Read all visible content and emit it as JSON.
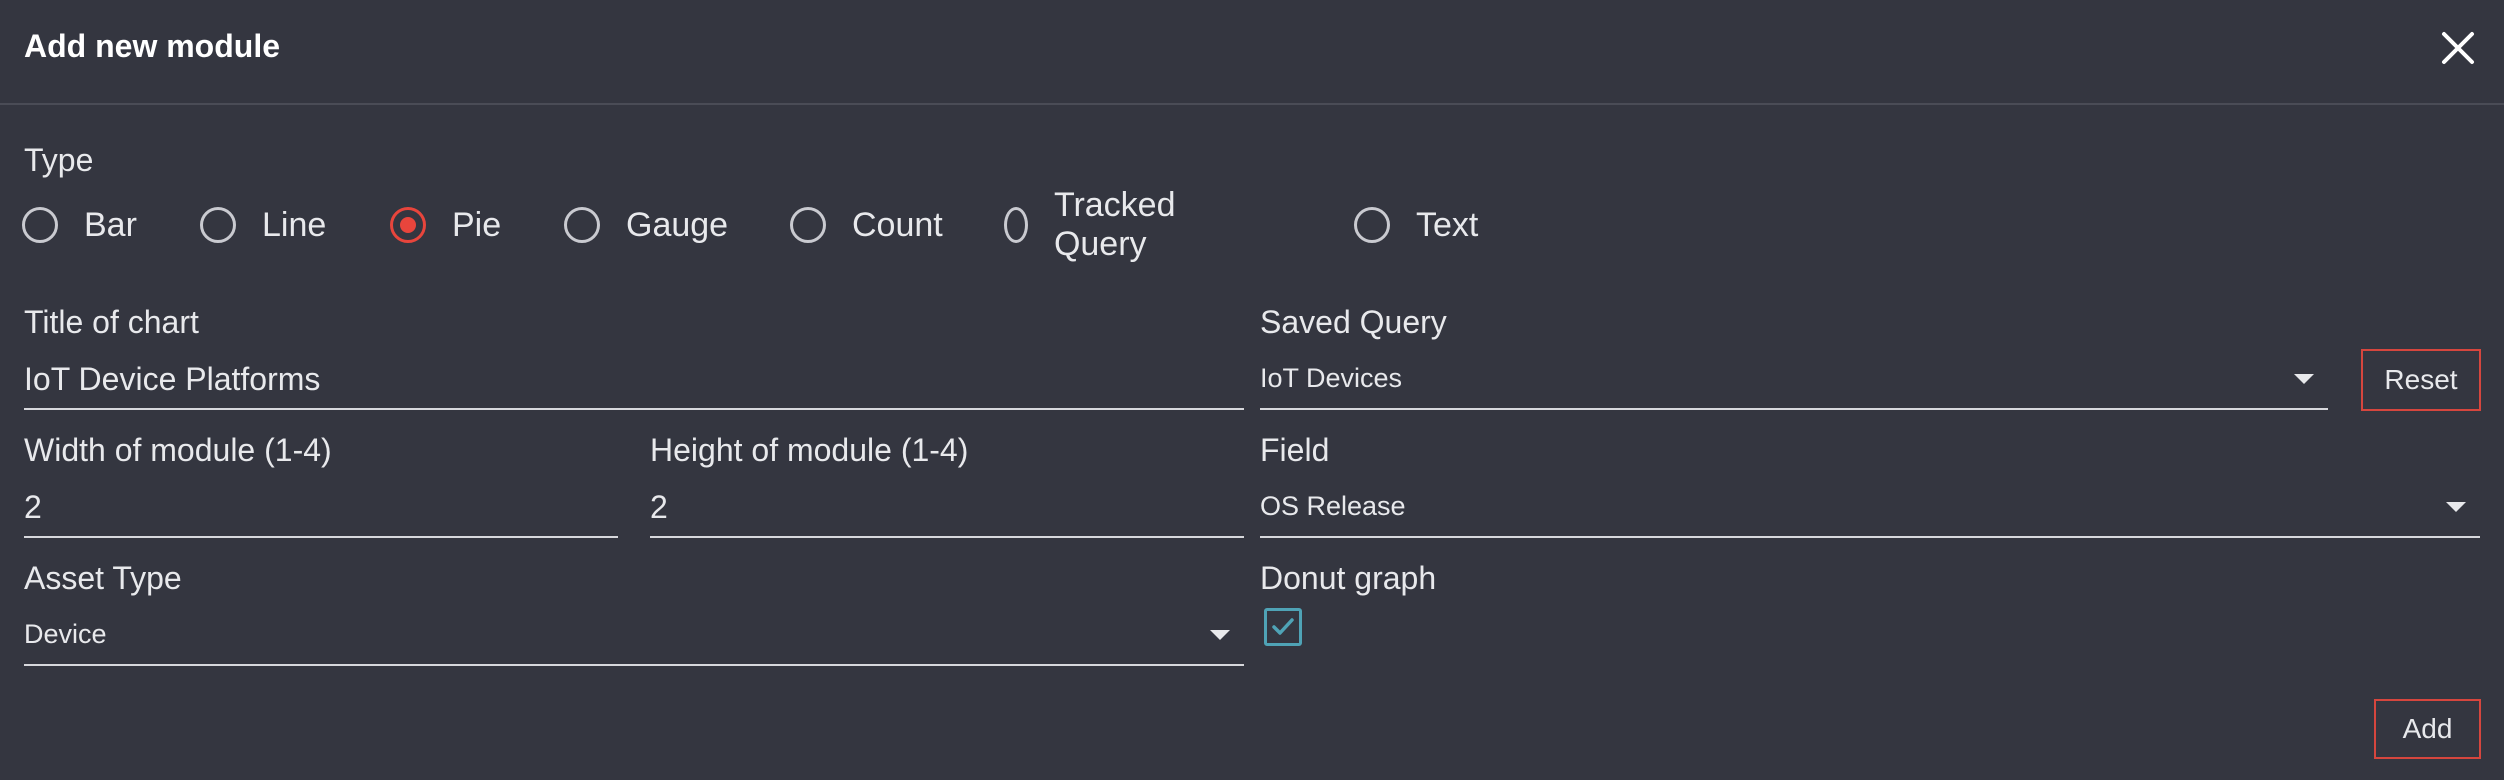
{
  "dialog": {
    "title": "Add new module",
    "close_icon": "close-icon"
  },
  "type": {
    "label": "Type",
    "options": [
      "Bar",
      "Line",
      "Pie",
      "Gauge",
      "Count",
      "Tracked Query",
      "Text"
    ],
    "selected": "Pie"
  },
  "title_of_chart": {
    "label": "Title of chart",
    "value": "IoT Device Platforms"
  },
  "saved_query": {
    "label": "Saved Query",
    "value": "IoT Devices",
    "reset_label": "Reset"
  },
  "width": {
    "label": "Width of module (1-4)",
    "value": "2"
  },
  "height": {
    "label": "Height of module (1-4)",
    "value": "2"
  },
  "field": {
    "label": "Field",
    "value": "OS Release"
  },
  "asset_type": {
    "label": "Asset Type",
    "value": "Device"
  },
  "donut": {
    "label": "Donut graph",
    "checked": true
  },
  "actions": {
    "add_label": "Add"
  },
  "colors": {
    "background": "#343640",
    "accent_red": "#e8453c",
    "checkbox_teal": "#4fa3b6"
  }
}
